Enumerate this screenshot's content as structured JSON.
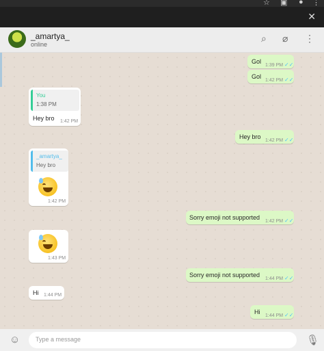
{
  "header": {
    "contact_name": "_amartya_",
    "status": "online"
  },
  "messages": [
    {
      "dir": "out",
      "text": "Gol",
      "time": "1:39 PM"
    },
    {
      "dir": "out",
      "text": "Gol",
      "time": "1:42 PM"
    },
    {
      "dir": "in",
      "quote_name": "You",
      "quote_text": "1:38 PM",
      "text": "Hey bro",
      "time": "1:42 PM"
    },
    {
      "dir": "out",
      "text": "Hey bro",
      "time": "1:42 PM"
    },
    {
      "dir": "in",
      "quote_name": "_amartya_",
      "quote_text": "Hey bro",
      "emoji": "grinning-sweat-emoji",
      "time": "1:42 PM"
    },
    {
      "dir": "out",
      "text": "Sorry emoji not supported",
      "time": "1:42 PM"
    },
    {
      "dir": "in",
      "emoji": "grinning-sweat-emoji",
      "time": "1:43 PM"
    },
    {
      "dir": "out",
      "text": "Sorry emoji not supported",
      "time": "1:44 PM"
    },
    {
      "dir": "in",
      "text": "Hi",
      "time": "1:44 PM"
    },
    {
      "dir": "out",
      "text": "Hi",
      "time": "1:44 PM"
    }
  ],
  "composer": {
    "placeholder": "Type a message"
  },
  "icons": {
    "read_tick": "✓✓"
  }
}
